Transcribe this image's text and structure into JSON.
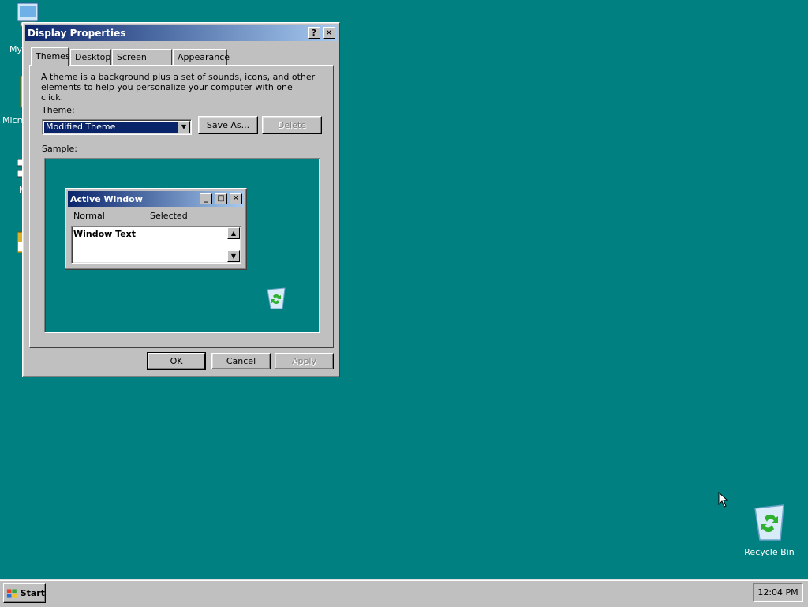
{
  "desktop": {
    "icons": [
      {
        "label": "My",
        "icon": "my-computer-icon"
      },
      {
        "label": "Micro",
        "icon": "folder-icon"
      },
      {
        "label": "M",
        "icon": "network-icon"
      },
      {
        "label": "Recycle Bin",
        "icon": "recycle-bin-icon"
      }
    ]
  },
  "dialog": {
    "title": "Display Properties",
    "help_button": "?",
    "close_button": "✕",
    "tabs": [
      {
        "label": "Themes",
        "active": true
      },
      {
        "label": "Desktop",
        "active": false
      },
      {
        "label": "Screen Saver",
        "active": false
      },
      {
        "label": "Appearance",
        "active": false
      }
    ],
    "description": "A theme is a background plus a set of sounds, icons, and other elements to help you personalize your computer with one click.",
    "theme_label": "Theme:",
    "theme_value": "Modified Theme",
    "save_as": "Save As...",
    "delete": "Delete",
    "sample_label": "Sample:",
    "sample": {
      "window_title": "Active Window",
      "menu_normal": "Normal",
      "menu_selected": "Selected",
      "window_text": "Window Text"
    },
    "ok": "OK",
    "cancel": "Cancel",
    "apply": "Apply"
  },
  "taskbar": {
    "start": "Start",
    "clock": "12:04 PM"
  },
  "colors": {
    "desktop": "#008080",
    "titlebar_start": "#0a246a",
    "titlebar_end": "#a6caf0",
    "face": "#c0c0c0"
  }
}
